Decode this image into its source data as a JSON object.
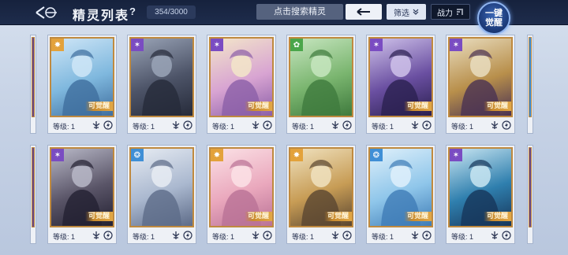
{
  "header": {
    "title": "精灵列表",
    "help": "?",
    "count": "354/3000",
    "search_placeholder": "点击搜索精灵",
    "filter_label": "筛选",
    "power_label": "战力",
    "awaken_all_label": "一键觉醒"
  },
  "level_label": "等级: 1",
  "awaken_tag": "可觉醒",
  "cards": [
    {
      "element": "light",
      "element_color": "#e3a23b",
      "bg": [
        "#cfe6f7",
        "#7fb8de",
        "#3f6e9e"
      ],
      "awakenable": true
    },
    {
      "element": "dark",
      "element_color": "#7a4cc2",
      "bg": [
        "#9aa4b7",
        "#4d5468",
        "#262b3a"
      ],
      "awakenable": false
    },
    {
      "element": "dark",
      "element_color": "#7a4cc2",
      "bg": [
        "#f3e6c9",
        "#d8a4d2",
        "#8b5fa8"
      ],
      "awakenable": true
    },
    {
      "element": "wood",
      "element_color": "#4aa64a",
      "bg": [
        "#c7e6c0",
        "#7ab56f",
        "#3f7a3d"
      ],
      "awakenable": false
    },
    {
      "element": "dark",
      "element_color": "#7a4cc2",
      "bg": [
        "#cfc2ea",
        "#6a4fa1",
        "#2b2050"
      ],
      "awakenable": true
    },
    {
      "element": "dark",
      "element_color": "#7a4cc2",
      "bg": [
        "#e9ddbf",
        "#b88f4b",
        "#4a3252"
      ],
      "awakenable": true
    },
    {
      "element": "dark",
      "element_color": "#7a4cc2",
      "bg": [
        "#b9b9c8",
        "#5a5568",
        "#232132"
      ],
      "awakenable": true
    },
    {
      "element": "water",
      "element_color": "#3f8fd6",
      "bg": [
        "#e7ecf3",
        "#aab8cf",
        "#5d6b88"
      ],
      "awakenable": false
    },
    {
      "element": "light",
      "element_color": "#e3a23b",
      "bg": [
        "#fbe2e6",
        "#eaa8bd",
        "#b97296"
      ],
      "awakenable": true
    },
    {
      "element": "light",
      "element_color": "#e3a23b",
      "bg": [
        "#f0e2bf",
        "#c79c55",
        "#5a4631"
      ],
      "awakenable": true
    },
    {
      "element": "water",
      "element_color": "#3f8fd6",
      "bg": [
        "#dff0fb",
        "#8fc6ea",
        "#3e7cb6"
      ],
      "awakenable": true
    },
    {
      "element": "dark",
      "element_color": "#7a4cc2",
      "bg": [
        "#c9e6f2",
        "#2f7fae",
        "#17365a"
      ],
      "awakenable": true
    }
  ],
  "colors": {
    "topbar": "#16223d",
    "card_border": "#c08a3f",
    "awaken_tag": "#c98b2e"
  },
  "icons": {
    "back": "back-arrow-icon",
    "search": "left-arrow-icon",
    "filter": "chevron-down-icon",
    "power": "sort-icon"
  }
}
